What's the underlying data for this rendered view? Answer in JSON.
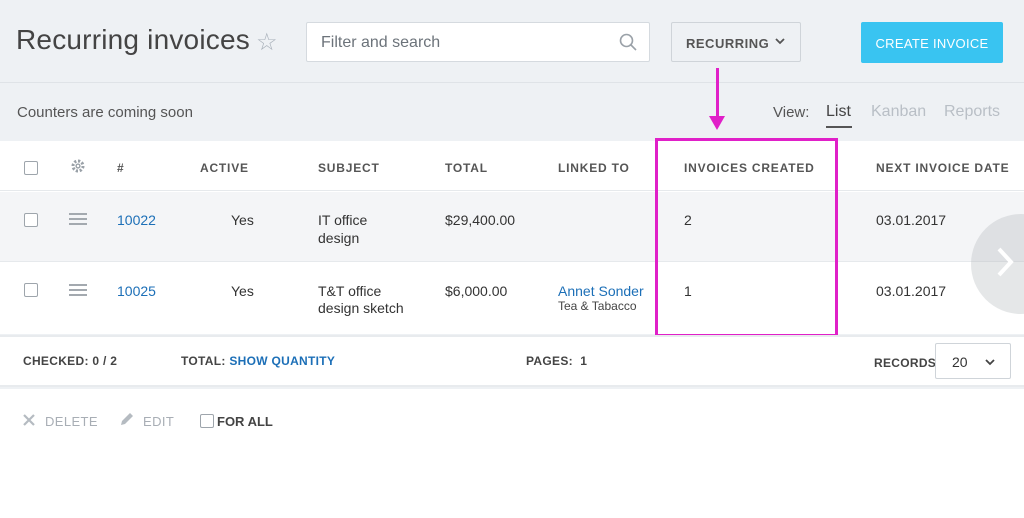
{
  "header": {
    "title": "Recurring invoices",
    "search_placeholder": "Filter and search",
    "filter_label": "RECURRING",
    "create_label": "CREATE INVOICE"
  },
  "subbar": {
    "counters_text": "Counters are coming soon",
    "view_label": "View:",
    "views": [
      "List",
      "Kanban",
      "Reports"
    ],
    "active_view": "List"
  },
  "table": {
    "columns": [
      "#",
      "ACTIVE",
      "SUBJECT",
      "TOTAL",
      "LINKED TO",
      "INVOICES CREATED",
      "NEXT INVOICE DATE"
    ],
    "rows": [
      {
        "number": "10022",
        "active": "Yes",
        "subject_line1": "IT office",
        "subject_line2": "design",
        "total": "$29,400.00",
        "linked_name": "",
        "linked_company": "",
        "invoices_created": "2",
        "next_invoice_date": "03.01.2017"
      },
      {
        "number": "10025",
        "active": "Yes",
        "subject_line1": "T&T office",
        "subject_line2": "design sketch",
        "total": "$6,000.00",
        "linked_name": "Annet Sonder",
        "linked_company": "Tea & Tabacco",
        "invoices_created": "1",
        "next_invoice_date": "03.01.2017"
      }
    ]
  },
  "footer": {
    "checked_label": "CHECKED:",
    "checked_value": "0 / 2",
    "total_label": "TOTAL:",
    "total_link": "SHOW QUANTITY",
    "pages_label": "PAGES:",
    "pages_value": "1",
    "records_label": "RECORDS:",
    "records_value": "20"
  },
  "actions": {
    "delete_label": "DELETE",
    "edit_label": "EDIT",
    "for_all_label": "FOR ALL"
  },
  "colors": {
    "accent": "#39c4f1",
    "link": "#1c6fb7",
    "highlight": "#e020c8"
  }
}
